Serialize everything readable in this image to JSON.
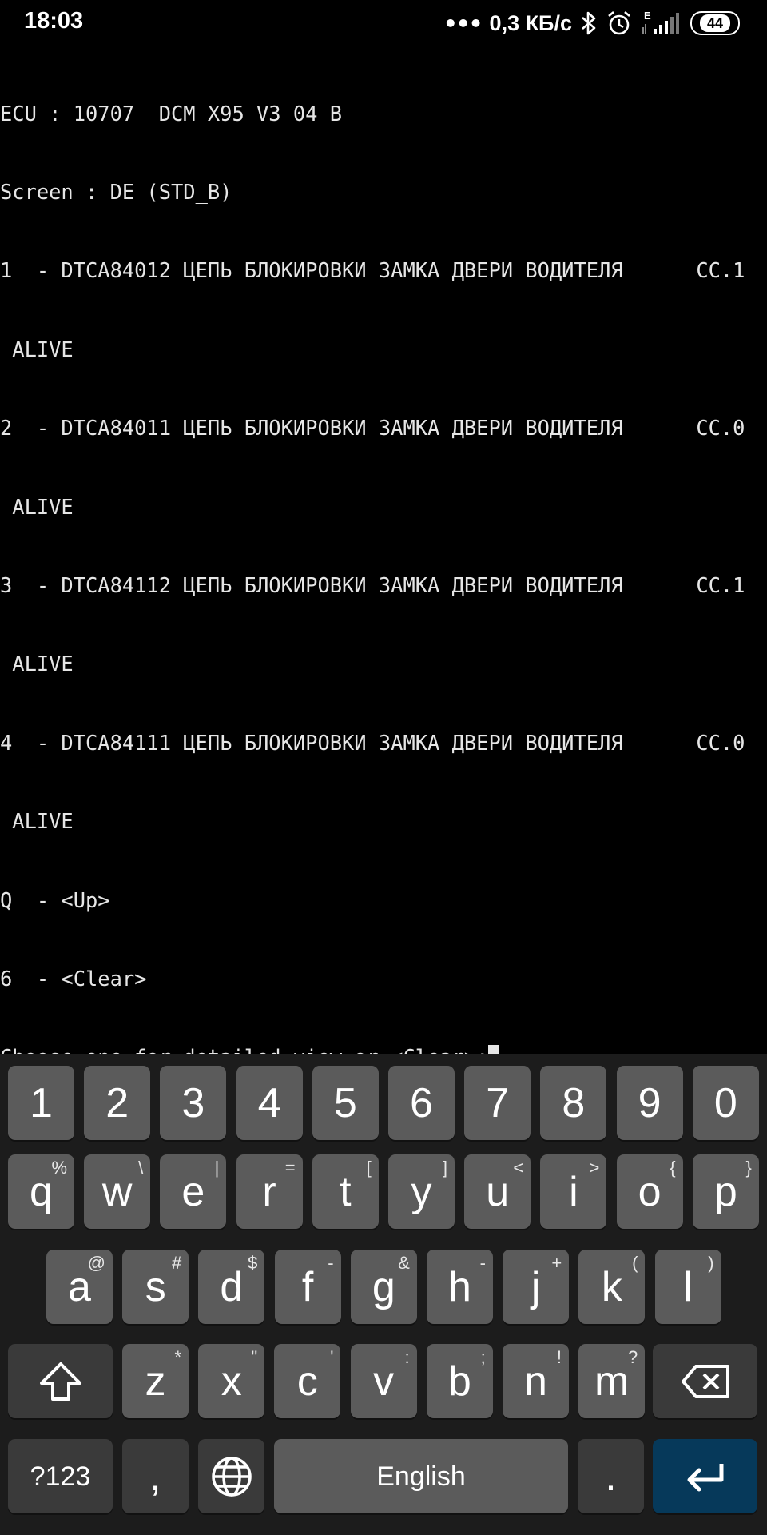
{
  "status_bar": {
    "time": "18:03",
    "dots": "•••",
    "net_speed": "0,3 КБ/с",
    "network_type": "E",
    "battery": "44",
    "icons": [
      "bluetooth-icon",
      "alarm-icon",
      "signal-icon",
      "battery-icon"
    ]
  },
  "terminal": {
    "lines": [
      "ECU : 10707  DCM X95 V3 04 B",
      "Screen : DE (STD_B)",
      "1  - DTCA84012 ЦЕПЬ БЛОКИРОВКИ ЗАМКА ДВЕРИ ВОДИТЕЛЯ      CC.1",
      " ALIVE",
      "2  - DTCA84011 ЦЕПЬ БЛОКИРОВКИ ЗАМКА ДВЕРИ ВОДИТЕЛЯ      CC.0",
      " ALIVE",
      "3  - DTCA84112 ЦЕПЬ БЛОКИРОВКИ ЗАМКА ДВЕРИ ВОДИТЕЛЯ      CC.1",
      " ALIVE",
      "4  - DTCA84111 ЦЕПЬ БЛОКИРОВКИ ЗАМКА ДВЕРИ ВОДИТЕЛЯ      CC.0",
      " ALIVE",
      "Q  - <Up>",
      "6  - <Clear>"
    ],
    "prompt": "Choose one for detailed view or <Clear>:"
  },
  "keyboard": {
    "number_row": [
      "1",
      "2",
      "3",
      "4",
      "5",
      "6",
      "7",
      "8",
      "9",
      "0"
    ],
    "row1": [
      {
        "key": "q",
        "hint": "%"
      },
      {
        "key": "w",
        "hint": "\\"
      },
      {
        "key": "e",
        "hint": "|"
      },
      {
        "key": "r",
        "hint": "="
      },
      {
        "key": "t",
        "hint": "["
      },
      {
        "key": "y",
        "hint": "]"
      },
      {
        "key": "u",
        "hint": "<"
      },
      {
        "key": "i",
        "hint": ">"
      },
      {
        "key": "o",
        "hint": "{"
      },
      {
        "key": "p",
        "hint": "}"
      }
    ],
    "row2": [
      {
        "key": "a",
        "hint": "@"
      },
      {
        "key": "s",
        "hint": "#"
      },
      {
        "key": "d",
        "hint": "$"
      },
      {
        "key": "f",
        "hint": "-"
      },
      {
        "key": "g",
        "hint": "&"
      },
      {
        "key": "h",
        "hint": "-"
      },
      {
        "key": "j",
        "hint": "+"
      },
      {
        "key": "k",
        "hint": "("
      },
      {
        "key": "l",
        "hint": ")"
      }
    ],
    "row3": [
      {
        "key": "z",
        "hint": "*"
      },
      {
        "key": "x",
        "hint": "\""
      },
      {
        "key": "c",
        "hint": "'"
      },
      {
        "key": "v",
        "hint": ":"
      },
      {
        "key": "b",
        "hint": ";"
      },
      {
        "key": "n",
        "hint": "!"
      },
      {
        "key": "m",
        "hint": "?"
      }
    ],
    "symbols_label": "?123",
    "comma_label": ",",
    "space_label": "English",
    "period_label": ".",
    "shift_icon": "shift-icon",
    "backspace_icon": "backspace-icon",
    "globe_icon": "globe-icon",
    "enter_icon": "enter-icon"
  }
}
